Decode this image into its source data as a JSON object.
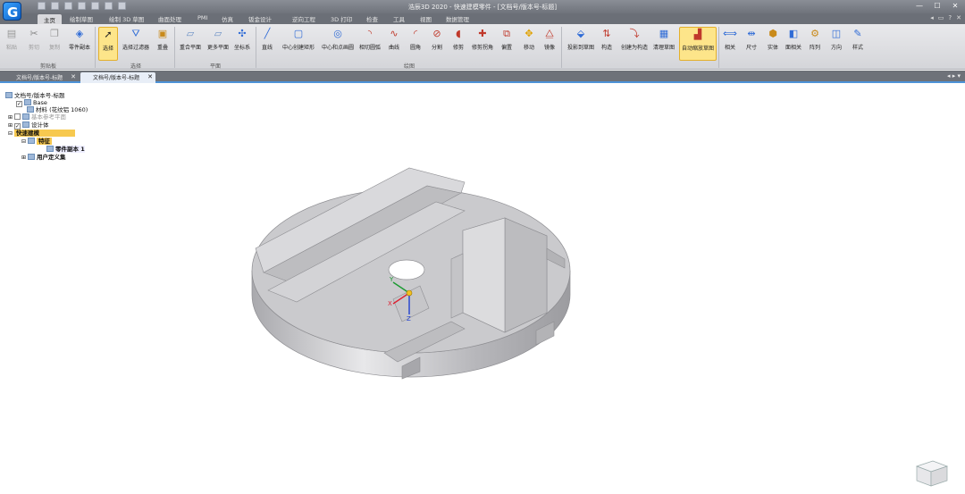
{
  "app": {
    "title": "浩辰3D 2020 - 快速建模零件 - [文档号/版本号-标题]"
  },
  "colors": {
    "accent": "#4d93d8",
    "highlight": "#fde58a",
    "model": "#c9c9cc"
  },
  "menu_tabs": [
    "主页",
    "绘制草图",
    "绘制 3D 草图",
    "曲面处理",
    "PMI",
    "仿真",
    "钣金设计",
    "逆向工程",
    "3D 打印",
    "检查",
    "工具",
    "视图",
    "数据管理"
  ],
  "ribbon": {
    "clipboard": {
      "paste": "粘贴",
      "cut": "剪切",
      "copy": "复制",
      "part_copy": "零件副本",
      "group": "剪贴板"
    },
    "select": {
      "select": "选择",
      "filter": "选择过滤器",
      "repeat": "重叠",
      "group": "选择"
    },
    "plane": {
      "coincident": "重合平面",
      "more": "更多平面",
      "coord": "坐标系",
      "group": "平面"
    },
    "draw": {
      "items": [
        "直线",
        "中心创建矩形",
        "中心和点画圆",
        "相切圆弧",
        "曲线",
        "圆角",
        "分割",
        "修剪",
        "延伸",
        "偏置",
        "移动",
        "镜像"
      ],
      "extra": [
        "修剪拐角"
      ],
      "group": "绘图"
    },
    "sketch_tools": {
      "project": "投影到草图",
      "construct": "构造",
      "create_construction": "创建为构造",
      "clear": "清理草图",
      "auto_scale": "自动缩放草图"
    },
    "relations": [
      "相关",
      "尺寸",
      "实体",
      "面相关",
      "阵列",
      "方向",
      "样式"
    ]
  },
  "doc_tabs": [
    "文档号/版本号-标题",
    "文档号/版本号-标题"
  ],
  "tree": {
    "root": "文档号/版本号-标题",
    "base": "Base",
    "material": "材料 (花纹铝 1060)",
    "ref_planes": "基本参考平面",
    "design_body": "设计体",
    "quick_model": "快速建模",
    "features": "特征",
    "part_copy": "零件副本 1",
    "user_sets": "用户定义集"
  },
  "axes": {
    "x": "X",
    "y": "Y",
    "z": "Z"
  }
}
